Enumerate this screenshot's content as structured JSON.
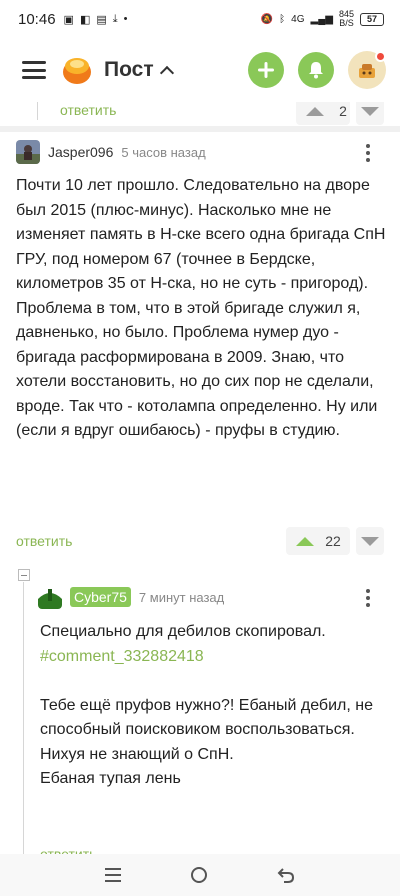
{
  "status": {
    "time": "10:46",
    "net_speed": "845",
    "net_unit": "B/S",
    "battery": "57",
    "signal": "4G"
  },
  "appbar": {
    "title": "Пост"
  },
  "prev_comment": {
    "reply_label": "ответить",
    "votes": "2"
  },
  "comment1": {
    "username": "Jasper096",
    "time": "5 часов назад",
    "text": "Почти 10 лет прошло. Следовательно на дворе был 2015 (плюс-минус). Насколько мне не изменяет память в Н-ске всего одна бригада СпН ГРУ, под номером 67 (точнее в Бердске, километров 35 от Н-ска, но не суть - пригород). Проблема в том, что в этой бригаде служил я, давненько, но было. Проблема нумер дуо - бригада расформирована в 2009. Знаю, что хотели восстановить, но до сих пор не сделали, вроде. Так что - котолампа определенно. Ну или (если я вдруг ошибаюсь) - пруфы в студию.",
    "reply_label": "ответить",
    "votes": "22"
  },
  "comment2": {
    "username": "Cyber75",
    "time": "7 минут назад",
    "line1": "Специально для дебилов скопировал.",
    "link": "#comment_332882418",
    "line2": "Тебе ещё пруфов нужно?! Ебаный дебил, не способный поисковиком воспользоваться.",
    "line3": "Нихуя не знающий о СпН.",
    "line4": "Ебаная тупая лень",
    "reply_label": "ответить"
  },
  "colors": {
    "accent": "#8ac858",
    "link": "#8ab653"
  }
}
